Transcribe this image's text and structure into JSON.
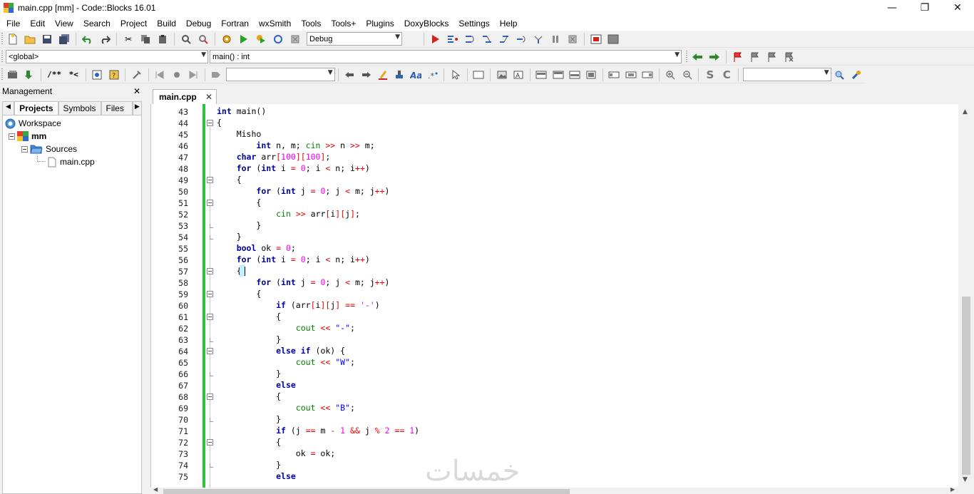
{
  "window": {
    "title": "main.cpp [mm] - Code::Blocks 16.01",
    "minimize_glyph": "—",
    "restore_glyph": "❐",
    "close_glyph": "✕"
  },
  "menu": [
    "File",
    "Edit",
    "View",
    "Search",
    "Project",
    "Build",
    "Debug",
    "Fortran",
    "wxSmith",
    "Tools",
    "Tools+",
    "Plugins",
    "DoxyBlocks",
    "Settings",
    "Help"
  ],
  "toolbar": {
    "build_target": "Debug",
    "scope_combo": "<global>",
    "function_combo": "main() : int",
    "doxy_comment_label": "/**",
    "doxy_line_label": "*<",
    "search_combo": "",
    "wx_combo": ""
  },
  "management": {
    "title": "Management",
    "close_glyph": "✕",
    "tabs": [
      "Projects",
      "Symbols",
      "Files"
    ],
    "tree": {
      "workspace": "Workspace",
      "project": "mm",
      "folder": "Sources",
      "file": "main.cpp"
    }
  },
  "editor": {
    "tab_label": "main.cpp",
    "tab_close": "✕",
    "lines": [
      {
        "n": "43",
        "code": "int main()"
      },
      {
        "n": "44",
        "code": "{"
      },
      {
        "n": "45",
        "code": "    Misho"
      },
      {
        "n": "46",
        "code": "        int n, m; cin >> n >> m;"
      },
      {
        "n": "47",
        "code": "    char arr[100][100];"
      },
      {
        "n": "48",
        "code": "    for (int i = 0; i < n; i++)"
      },
      {
        "n": "49",
        "code": "    {"
      },
      {
        "n": "50",
        "code": "        for (int j = 0; j < m; j++)"
      },
      {
        "n": "51",
        "code": "        {"
      },
      {
        "n": "52",
        "code": "            cin >> arr[i][j];"
      },
      {
        "n": "53",
        "code": "        }"
      },
      {
        "n": "54",
        "code": "    }"
      },
      {
        "n": "55",
        "code": "    bool ok = 0;"
      },
      {
        "n": "56",
        "code": "    for (int i = 0; i < n; i++)"
      },
      {
        "n": "57",
        "code": "    {"
      },
      {
        "n": "58",
        "code": "        for (int j = 0; j < m; j++)"
      },
      {
        "n": "59",
        "code": "        {"
      },
      {
        "n": "60",
        "code": "            if (arr[i][j] == '-')"
      },
      {
        "n": "61",
        "code": "            {"
      },
      {
        "n": "62",
        "code": "                cout << \"-\";"
      },
      {
        "n": "63",
        "code": "            }"
      },
      {
        "n": "64",
        "code": "            else if (ok) {"
      },
      {
        "n": "65",
        "code": "                cout << \"W\";"
      },
      {
        "n": "66",
        "code": "            }"
      },
      {
        "n": "67",
        "code": "            else"
      },
      {
        "n": "68",
        "code": "            {"
      },
      {
        "n": "69",
        "code": "                cout << \"B\";"
      },
      {
        "n": "70",
        "code": "            }"
      },
      {
        "n": "71",
        "code": "            if (j == m - 1 && j % 2 == 1)"
      },
      {
        "n": "72",
        "code": "            {"
      },
      {
        "n": "73",
        "code": "                ok = ok;"
      },
      {
        "n": "74",
        "code": "            }"
      },
      {
        "n": "75",
        "code": "            else"
      }
    ]
  },
  "watermark": "خمسات",
  "colors": {
    "keyword": "#0000a0",
    "number": "#f000f0",
    "operator": "#f00000",
    "string": "#0000ff",
    "change_bar": "#31c13a"
  }
}
